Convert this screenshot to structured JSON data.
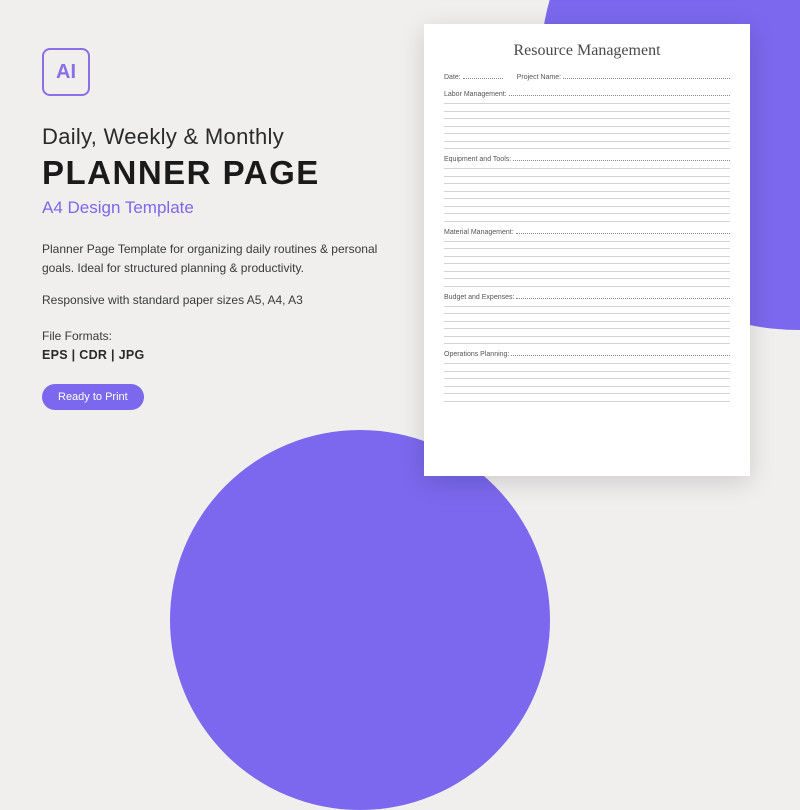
{
  "bg": {
    "accent": "#7b68ee"
  },
  "left": {
    "ai_label": "AI",
    "heading_line1": "Daily, Weekly & Monthly",
    "heading_line2": "PLANNER PAGE",
    "subheading": "A4 Design Template",
    "description": "Planner Page Template for organizing daily routines & personal goals. Ideal for structured planning & productivity.",
    "responsive": "Responsive with standard paper sizes A5, A4, A3",
    "formats_label": "File Formats:",
    "formats_list": "EPS  |  CDR  |  JPG",
    "ready_badge": "Ready to Print"
  },
  "page": {
    "title": "Resource Management",
    "meta": {
      "date_label": "Date:",
      "project_label": "Project Name:"
    },
    "sections": [
      {
        "label": "Labor Management:",
        "lines": 7
      },
      {
        "label": "Equipment and Tools:",
        "lines": 8
      },
      {
        "label": "Material Management:",
        "lines": 7
      },
      {
        "label": "Budget and Expenses:",
        "lines": 6
      },
      {
        "label": "Operations Planning:",
        "lines": 6
      }
    ]
  }
}
